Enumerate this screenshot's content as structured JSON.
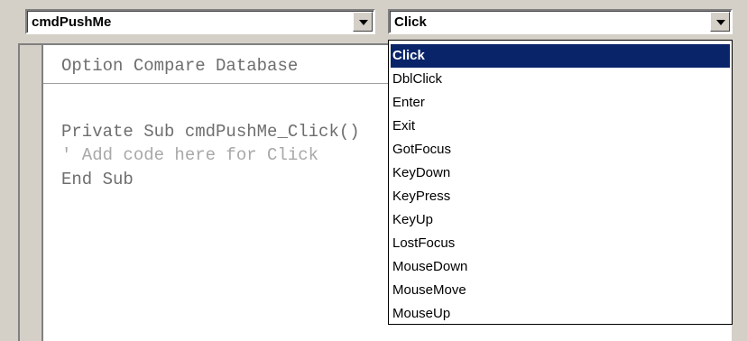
{
  "object_combo": {
    "value": "cmdPushMe"
  },
  "procedure_combo": {
    "value": "Click"
  },
  "code": {
    "line1": "Option Compare Database",
    "line2": "Private Sub cmdPushMe_Click()",
    "line3": "' Add code here for Click",
    "line4": "End Sub"
  },
  "dropdown": {
    "items": [
      "Click",
      "DblClick",
      "Enter",
      "Exit",
      "GotFocus",
      "KeyDown",
      "KeyPress",
      "KeyUp",
      "LostFocus",
      "MouseDown",
      "MouseMove",
      "MouseUp"
    ],
    "selected": "Click"
  },
  "colors": {
    "selection": "#0a246a",
    "background": "#d4d0c8",
    "comment": "#a8a8a8"
  },
  "icons": {
    "combo_button": "chevron-down-icon"
  }
}
